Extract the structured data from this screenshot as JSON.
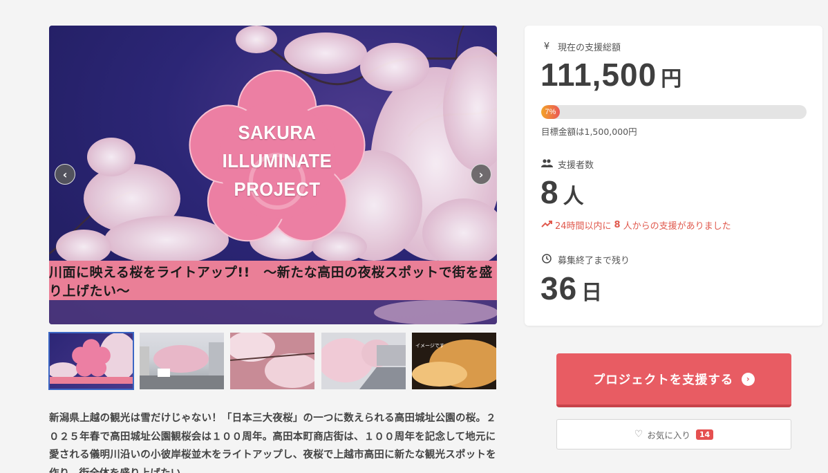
{
  "hero": {
    "logo_lines": [
      "SAKURA",
      "ILLUMINATE",
      "PROJECT"
    ],
    "banner_text": "川面に映える桜をライトアップ!!　～新たな高田の夜桜スポットで街を盛り上げたい～",
    "prev_icon": "chevron-left-icon",
    "next_icon": "chevron-right-icon",
    "prev_label": "‹",
    "next_label": "›"
  },
  "thumbnails": [
    {
      "name": "thumb-logo",
      "active": true
    },
    {
      "name": "thumb-street"
    },
    {
      "name": "thumb-river-blossoms"
    },
    {
      "name": "thumb-riverbank"
    },
    {
      "name": "thumb-night-illumination",
      "label": "イメージです"
    }
  ],
  "description": "新潟県上越の観光は雪だけじゃない！「日本三大夜桜」の一つに数えられる高田城址公園の桜。２０２５年春で高田城址公園観桜会は１００周年。高田本町商店街は、１００周年を記念して地元に愛される儀明川沿いの小彼岸桜並木をライトアップし、夜桜で上越市高田に新たな観光スポットを作り、街全体を盛り上げたい。",
  "stats": {
    "total_label": "現在の支援総額",
    "total_icon": "yen-icon",
    "total_value": "111,500",
    "total_unit": "円",
    "progress_percent": 7,
    "progress_text": "7%",
    "goal_text": "目標金額は1,500,000円",
    "backers_label": "支援者数",
    "backers_icon": "users-icon",
    "backers_value": "8",
    "backers_unit": "人",
    "recent_pre": "24時間以内に",
    "recent_count": "8",
    "recent_post": "人からの支援がありました",
    "recent_icon": "trending-up-icon",
    "remaining_label": "募集終了まで残り",
    "remaining_icon": "clock-icon",
    "remaining_value": "36",
    "remaining_unit": "日"
  },
  "actions": {
    "support_label": "プロジェクトを支援する",
    "favorite_label": "お気に入り",
    "favorite_count": "14"
  },
  "colors": {
    "accent": "#e85c63",
    "banner_pink": "#ea7f97",
    "progress_start": "#f3a427",
    "progress_end": "#ea5757"
  }
}
